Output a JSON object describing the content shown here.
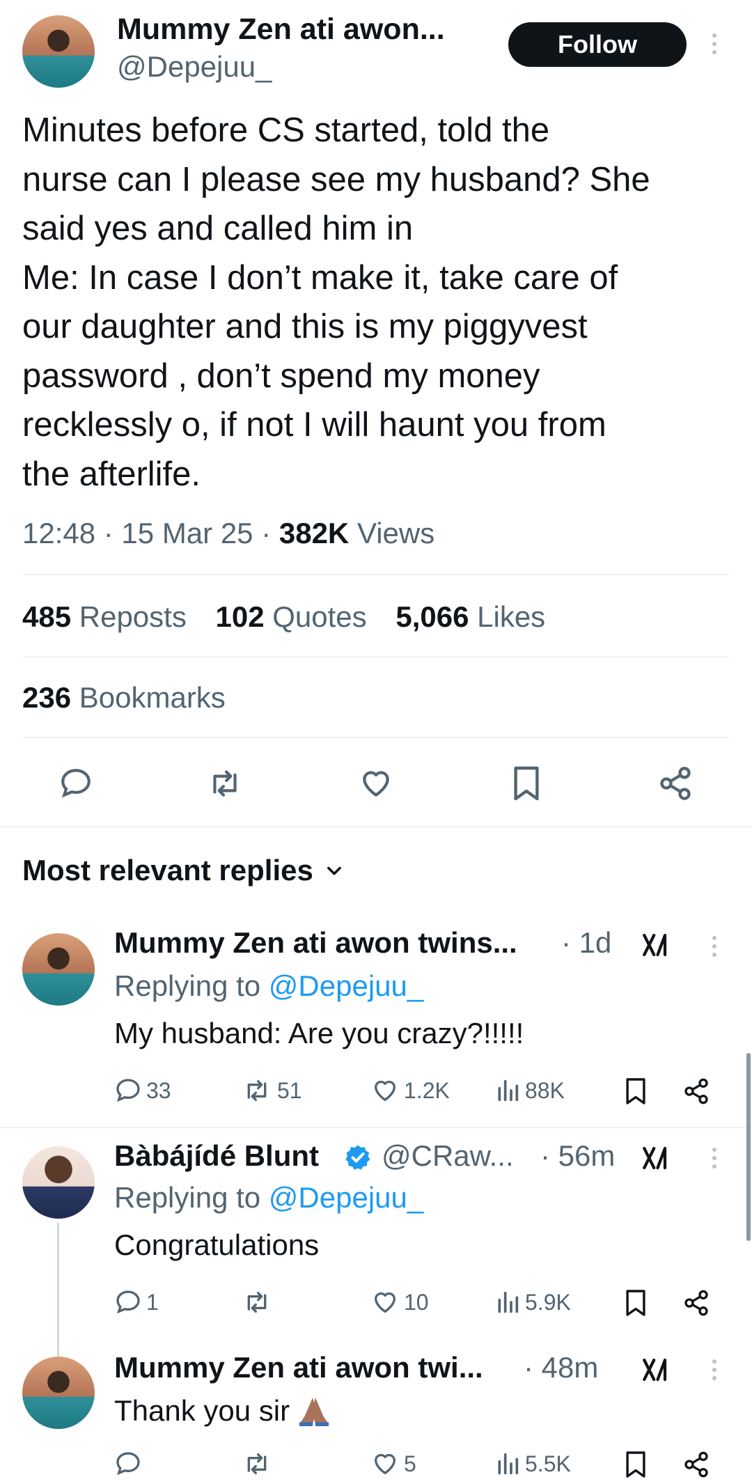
{
  "tweet": {
    "author_name": "Mummy Zen ati awon...",
    "handle": "@Depejuu_",
    "follow_label": "Follow",
    "lines": [
      "Minutes before CS started, told the",
      "nurse can I please see my husband? She",
      "said yes and called him in",
      "Me: In case I don’t make it, take care of",
      "our daughter and this is my piggyvest",
      "password , don’t spend my money",
      "recklessly o, if not I will haunt you from",
      "the afterlife."
    ],
    "time": "12:48 · 15 Mar 25 ·",
    "views_count": "382K",
    "views_label": "Views",
    "reposts_count": "485",
    "reposts_label": "Reposts",
    "quotes_count": "102",
    "quotes_label": "Quotes",
    "likes_count": "5,066",
    "likes_label": "Likes",
    "bookmarks_count": "236",
    "bookmarks_label": "Bookmarks"
  },
  "replies_header": {
    "label": "Most relevant replies"
  },
  "replies": [
    {
      "name": "Mummy Zen ati awon twins...",
      "time": "· 1d",
      "replying_prefix": "Replying to",
      "replying_handle": "@Depejuu_",
      "text": "My husband: Are you crazy?!!!!!",
      "replies": "33",
      "reposts": "51",
      "likes": "1.2K",
      "views": "88K"
    },
    {
      "name": "Bàbájídé Blunt",
      "handle": "@CRaw...",
      "time": "· 56m",
      "replying_prefix": "Replying to",
      "replying_handle": "@Depejuu_",
      "text": "Congratulations",
      "replies": "1",
      "reposts": "",
      "likes": "10",
      "views": "5.9K"
    },
    {
      "name": "Mummy Zen ati awon twi...",
      "time": "· 48m",
      "text": "Thank you sir",
      "replies": "",
      "reposts": "",
      "likes": "5",
      "views": "5.5K"
    }
  ],
  "colors": {
    "accent": "#1d9bf0",
    "text": "#0f1419",
    "muted": "#536471",
    "divider": "#eff3f4"
  },
  "icons": [
    "more-icon",
    "reply-icon",
    "repost-icon",
    "like-icon",
    "bookmark-icon",
    "share-icon",
    "views-icon",
    "grok-icon",
    "verified-icon",
    "chevron-down-icon",
    "praying-hands-emoji"
  ]
}
